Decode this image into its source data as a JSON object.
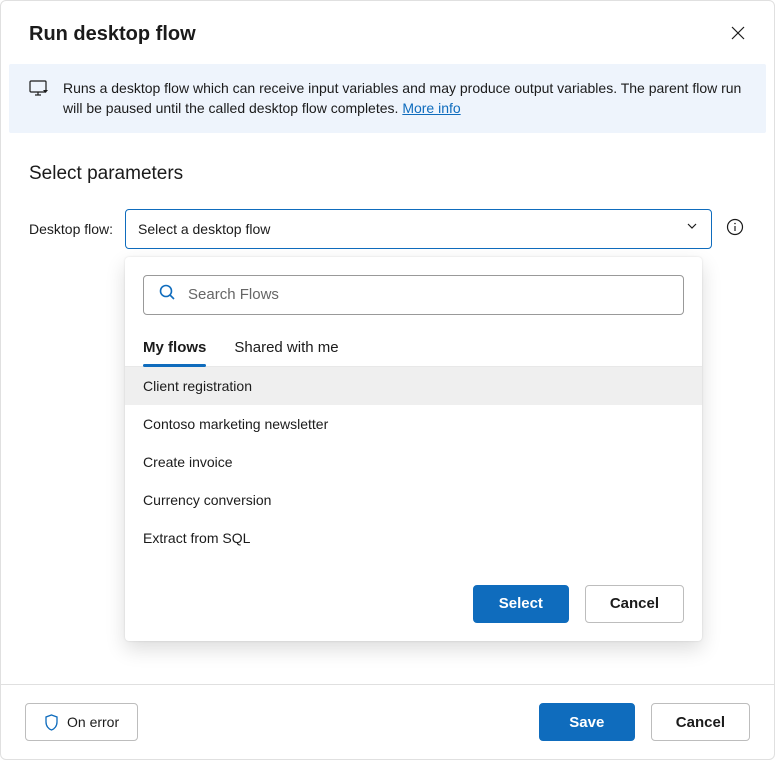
{
  "title": "Run desktop flow",
  "banner": {
    "text": "Runs a desktop flow which can receive input variables and may produce output variables. The parent flow run will be paused until the called desktop flow completes. ",
    "link": "More info"
  },
  "section_heading": "Select parameters",
  "field": {
    "label": "Desktop flow:",
    "placeholder": "Select a desktop flow"
  },
  "popover": {
    "search_placeholder": "Search Flows",
    "tabs": {
      "my_flows": "My flows",
      "shared": "Shared with me"
    },
    "items": [
      "Client registration",
      "Contoso marketing newsletter",
      "Create invoice",
      "Currency conversion",
      "Extract from SQL"
    ],
    "select_label": "Select",
    "cancel_label": "Cancel"
  },
  "footer": {
    "on_error": "On error",
    "save": "Save",
    "cancel": "Cancel"
  }
}
